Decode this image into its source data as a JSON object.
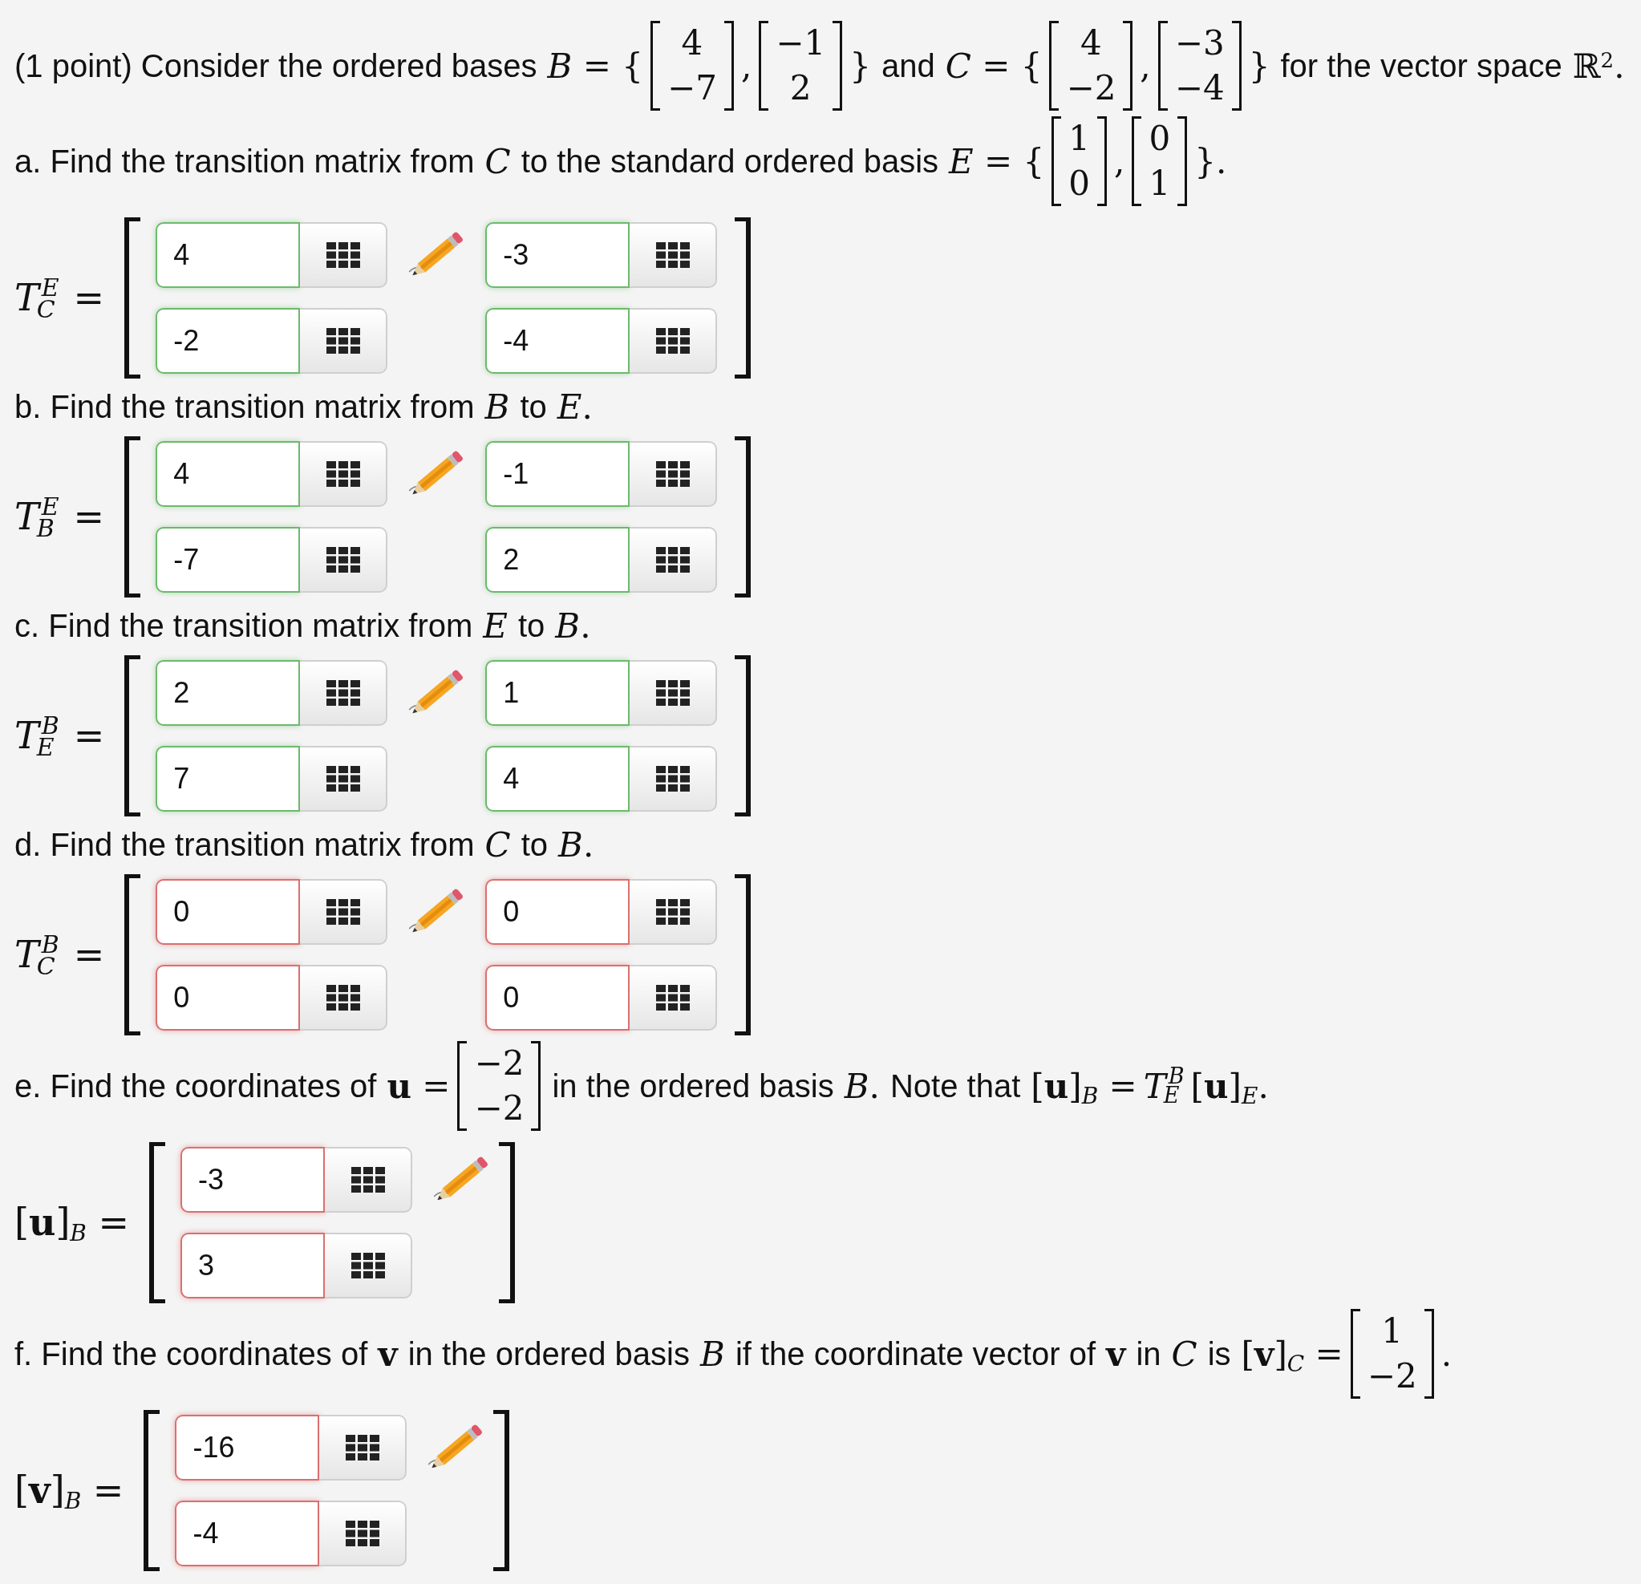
{
  "intro": [
    {
      "kind": "text",
      "text": "(1 point) Consider the ordered bases"
    },
    {
      "kind": "math",
      "text": "*B* = {"
    },
    {
      "kind": "vector",
      "entries": [
        "4",
        "−7"
      ]
    },
    {
      "kind": "math",
      "text": ","
    },
    {
      "kind": "vector",
      "entries": [
        "−1",
        "2"
      ]
    },
    {
      "kind": "math",
      "text": "}"
    },
    {
      "kind": "text",
      "text": "and"
    },
    {
      "kind": "math",
      "text": "*C* = {"
    },
    {
      "kind": "vector",
      "entries": [
        "4",
        "−2"
      ]
    },
    {
      "kind": "math",
      "text": ","
    },
    {
      "kind": "vector",
      "entries": [
        "−3",
        "−4"
      ]
    },
    {
      "kind": "math",
      "text": "}"
    },
    {
      "kind": "text",
      "text": "for the vector space"
    },
    {
      "kind": "math",
      "text": "ℝ$^{2}$."
    }
  ],
  "questions": [
    {
      "prompt": [
        {
          "kind": "text",
          "text": "a. Find the transition matrix from"
        },
        {
          "kind": "math",
          "text": "*C*"
        },
        {
          "kind": "text",
          "text": "to the standard ordered basis"
        },
        {
          "kind": "math",
          "text": "*E* = {"
        },
        {
          "kind": "vector",
          "entries": [
            "1",
            "0"
          ]
        },
        {
          "kind": "math",
          "text": ","
        },
        {
          "kind": "vector",
          "entries": [
            "0",
            "1"
          ]
        },
        {
          "kind": "math",
          "text": "}."
        }
      ],
      "answer": {
        "label": {
          "kind": "sym",
          "base": "T",
          "sup": "E",
          "sub": "C",
          "rel": "="
        },
        "rows": [
          [
            {
              "value": "4",
              "correct": true
            },
            {
              "value": "-3",
              "correct": true
            }
          ],
          [
            {
              "value": "-2",
              "correct": true
            },
            {
              "value": "-4",
              "correct": true
            }
          ]
        ]
      }
    },
    {
      "prompt": [
        {
          "kind": "text",
          "text": "b. Find the transition matrix from"
        },
        {
          "kind": "math",
          "text": "*B*"
        },
        {
          "kind": "text",
          "text": "to"
        },
        {
          "kind": "math",
          "text": "*E*."
        }
      ],
      "answer": {
        "label": {
          "kind": "sym",
          "base": "T",
          "sup": "E",
          "sub": "B",
          "rel": "="
        },
        "rows": [
          [
            {
              "value": "4",
              "correct": true
            },
            {
              "value": "-1",
              "correct": true
            }
          ],
          [
            {
              "value": "-7",
              "correct": true
            },
            {
              "value": "2",
              "correct": true
            }
          ]
        ]
      }
    },
    {
      "prompt": [
        {
          "kind": "text",
          "text": "c. Find the transition matrix from"
        },
        {
          "kind": "math",
          "text": "*E*"
        },
        {
          "kind": "text",
          "text": "to"
        },
        {
          "kind": "math",
          "text": "*B*."
        }
      ],
      "answer": {
        "label": {
          "kind": "sym",
          "base": "T",
          "sup": "B",
          "sub": "E",
          "rel": "="
        },
        "rows": [
          [
            {
              "value": "2",
              "correct": true
            },
            {
              "value": "1",
              "correct": true
            }
          ],
          [
            {
              "value": "7",
              "correct": true
            },
            {
              "value": "4",
              "correct": true
            }
          ]
        ]
      }
    },
    {
      "prompt": [
        {
          "kind": "text",
          "text": "d. Find the transition matrix from"
        },
        {
          "kind": "math",
          "text": "*C*"
        },
        {
          "kind": "text",
          "text": "to"
        },
        {
          "kind": "math",
          "text": "*B*."
        }
      ],
      "answer": {
        "label": {
          "kind": "sym",
          "base": "T",
          "sup": "B",
          "sub": "C",
          "rel": "="
        },
        "rows": [
          [
            {
              "value": "0",
              "correct": false
            },
            {
              "value": "0",
              "correct": false
            }
          ],
          [
            {
              "value": "0",
              "correct": false
            },
            {
              "value": "0",
              "correct": false
            }
          ]
        ]
      }
    },
    {
      "prompt": [
        {
          "kind": "text",
          "text": "e. Find the coordinates of"
        },
        {
          "kind": "math",
          "text": "**u** ="
        },
        {
          "kind": "vector",
          "entries": [
            "−2",
            "−2"
          ]
        },
        {
          "kind": "text",
          "text": "in the ordered basis"
        },
        {
          "kind": "math",
          "text": "*B*."
        },
        {
          "kind": "text",
          "text": "Note that"
        },
        {
          "kind": "math",
          "text": "[**u**]$_{B}$ ="
        },
        {
          "kind": "sym",
          "base": "T",
          "sup": "B",
          "sub": "E"
        },
        {
          "kind": "math",
          "text": "[**u**]$_{E}$."
        }
      ],
      "answer": {
        "label": {
          "kind": "math",
          "text": "[**u**]$_{B}$ ="
        },
        "rows": [
          [
            {
              "value": "-3",
              "correct": false
            }
          ],
          [
            {
              "value": "3",
              "correct": false
            }
          ]
        ]
      }
    },
    {
      "prompt": [
        {
          "kind": "text",
          "text": "f. Find the coordinates of"
        },
        {
          "kind": "math",
          "text": "**v**"
        },
        {
          "kind": "text",
          "text": "in the ordered basis"
        },
        {
          "kind": "math",
          "text": "*B*"
        },
        {
          "kind": "text",
          "text": "if the coordinate vector of"
        },
        {
          "kind": "math",
          "text": "**v**"
        },
        {
          "kind": "text",
          "text": "in"
        },
        {
          "kind": "math",
          "text": "*C*"
        },
        {
          "kind": "text",
          "text": "is"
        },
        {
          "kind": "math",
          "text": "[**v**]$_{C}$ ="
        },
        {
          "kind": "vector",
          "entries": [
            "1",
            "−2"
          ]
        },
        {
          "kind": "math",
          "text": "."
        }
      ],
      "answer": {
        "label": {
          "kind": "math",
          "text": "[**v**]$_{B}$ ="
        },
        "rows": [
          [
            {
              "value": "-16",
              "correct": false
            }
          ],
          [
            {
              "value": "-4",
              "correct": false
            }
          ]
        ]
      }
    }
  ]
}
